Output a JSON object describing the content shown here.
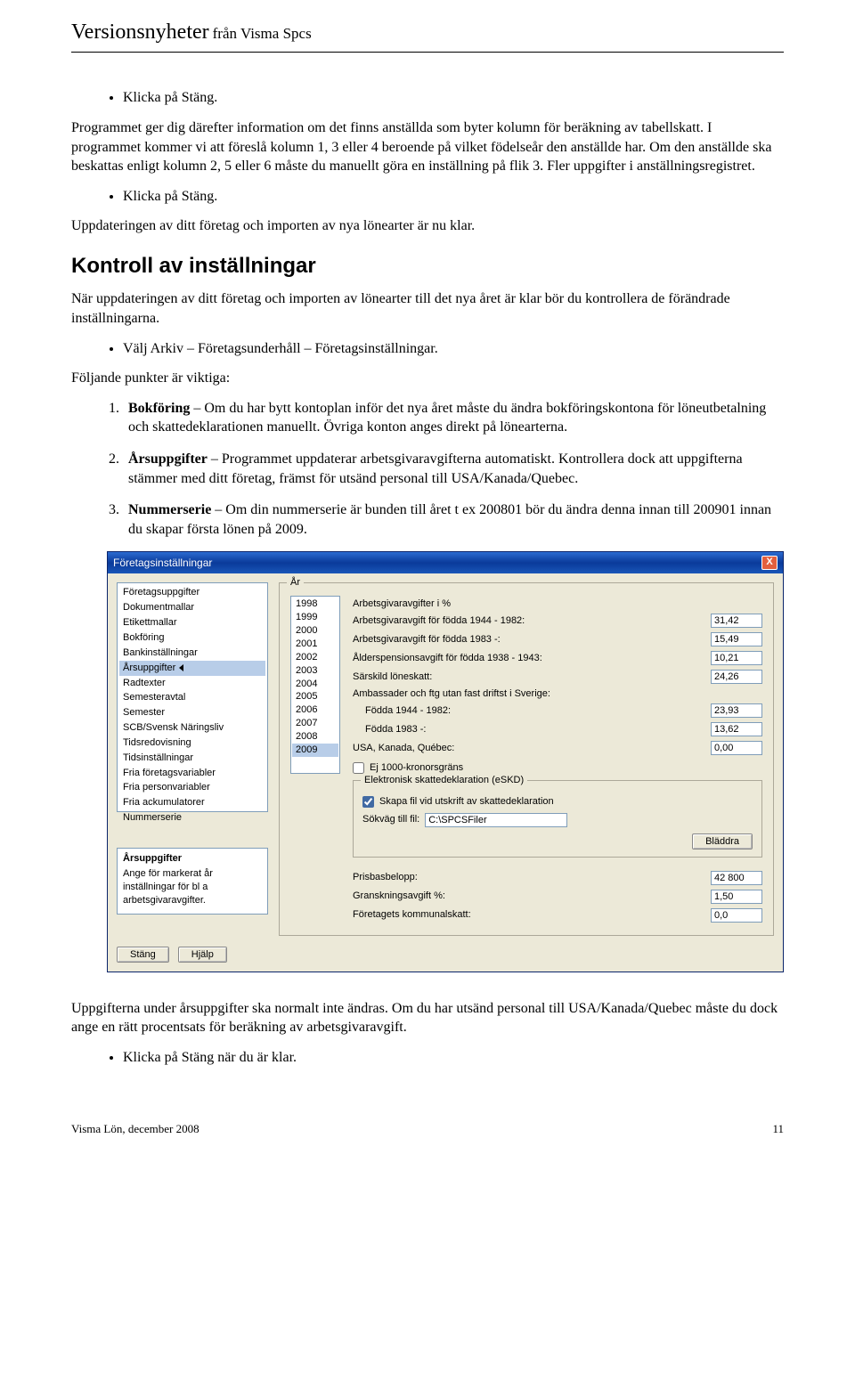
{
  "header": {
    "title": "Versionsnyheter",
    "subtitle": "från Visma Spcs"
  },
  "b1": "Klicka på Stäng.",
  "p1": "Programmet ger dig därefter information om det finns anställda som byter kolumn för beräkning av tabellskatt. I programmet kommer vi att föreslå kolumn 1, 3 eller 4 beroende på vilket födelseår den anställde har. Om den anställde ska beskattas enligt kolumn 2, 5 eller 6 måste du manuellt göra en inställning på flik 3. Fler uppgifter i anställningsregistret.",
  "b2": "Klicka på Stäng.",
  "p2": "Uppdateringen av ditt företag och importen av nya lönearter är nu klar.",
  "h2": "Kontroll av inställningar",
  "p3": "När uppdateringen av ditt företag och importen av lönearter till det nya året är klar bör du kontrollera de förändrade inställningarna.",
  "b3": "Välj Arkiv – Företagsunderhåll – Företagsinställningar.",
  "p4": "Följande punkter är viktiga:",
  "ol": [
    {
      "strong": "Bokföring",
      "text": " – Om du har bytt kontoplan inför det nya året måste du ändra bokföringskontona för löneutbetalning och skattedeklarationen manuellt. Övriga konton anges direkt på lönearterna."
    },
    {
      "strong": "Årsuppgifter",
      "text": " – Programmet uppdaterar arbetsgivaravgifterna automatiskt. Kontrollera dock att uppgifterna stämmer med ditt företag, främst för utsänd personal till USA/Kanada/Quebec."
    },
    {
      "strong": "Nummerserie",
      "text": " – Om din nummerserie är bunden till året t ex 200801 bör du ändra denna innan till 200901 innan du skapar första lönen på 2009."
    }
  ],
  "dialog": {
    "title": "Företagsinställningar",
    "close_x": "X",
    "list_items": [
      "Företagsuppgifter",
      "Dokumentmallar",
      "Etikettmallar",
      "Bokföring",
      "Bankinställningar",
      "Årsuppgifter",
      "Radtexter",
      "Semesteravtal",
      "Semester",
      "SCB/Svensk Näringsliv",
      "Tidsredovisning",
      "Tidsinställningar",
      "Fria företagsvariabler",
      "Fria personvariabler",
      "Fria ackumulatorer",
      "Nummerserie"
    ],
    "list_selected_index": 5,
    "help": {
      "title": "Årsuppgifter",
      "body": "Ange för markerat år inställningar för bl a arbetsgivaravgifter."
    },
    "group_legend": "År",
    "years": [
      "1998",
      "1999",
      "2000",
      "2001",
      "2002",
      "2003",
      "2004",
      "2005",
      "2006",
      "2007",
      "2008",
      "2009"
    ],
    "year_selected_index": 11,
    "section_heading": "Arbetsgivaravgifter i %",
    "rows": [
      {
        "label": "Arbetsgivaravgift för födda 1944 - 1982:",
        "value": "31,42"
      },
      {
        "label": "Arbetsgivaravgift för födda 1983 -:",
        "value": "15,49"
      },
      {
        "label": "Ålderspensionsavgift för födda 1938 - 1943:",
        "value": "10,21"
      },
      {
        "label": "Särskild löneskatt:",
        "value": "24,26"
      }
    ],
    "amb_heading": "Ambassader och ftg utan fast driftst i Sverige:",
    "amb_rows": [
      {
        "label": "Födda 1944 - 1982:",
        "value": "23,93"
      },
      {
        "label": "Födda 1983 -:",
        "value": "13,62"
      }
    ],
    "usa_row": {
      "label": "USA, Kanada, Québec:",
      "value": "0,00"
    },
    "cb_1000": "Ej 1000-kronorsgräns",
    "eskd_legend": "Elektronisk skattedeklaration (eSKD)",
    "cb_skapa": "Skapa fil vid utskrift av skattedeklaration",
    "path_label": "Sökväg till fil:",
    "path_value": "C:\\SPCSFiler",
    "bladdra": "Bläddra",
    "bottom_rows": [
      {
        "label": "Prisbasbelopp:",
        "value": "42 800"
      },
      {
        "label": "Granskningsavgift %:",
        "value": "1,50"
      },
      {
        "label": "Företagets kommunalskatt:",
        "value": "0,0"
      }
    ],
    "btn_stang": "Stäng",
    "btn_hjalp": "Hjälp"
  },
  "p5": "Uppgifterna under årsuppgifter ska normalt inte ändras. Om du har utsänd personal till USA/Kanada/Quebec måste du dock ange en rätt procentsats för beräkning av arbetsgivaravgift.",
  "b4": "Klicka på Stäng när du är klar.",
  "footer": {
    "left": "Visma Lön, december 2008",
    "right": "11"
  }
}
